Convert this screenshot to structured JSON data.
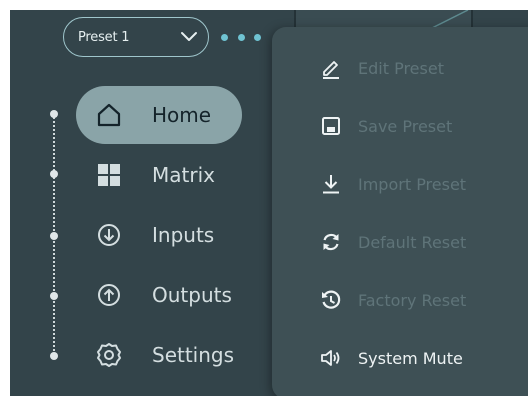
{
  "preset_selector": {
    "value": "Preset 1"
  },
  "nav": {
    "items": [
      {
        "label": "Home",
        "icon": "home-icon",
        "active": true
      },
      {
        "label": "Matrix",
        "icon": "grid-icon",
        "active": false
      },
      {
        "label": "Inputs",
        "icon": "arrow-down-circle-icon",
        "active": false
      },
      {
        "label": "Outputs",
        "icon": "arrow-up-circle-icon",
        "active": false
      },
      {
        "label": "Settings",
        "icon": "gear-icon",
        "active": false
      }
    ]
  },
  "preset_menu": {
    "items": [
      {
        "label": "Edit Preset",
        "icon": "pencil-icon",
        "enabled": false
      },
      {
        "label": "Save Preset",
        "icon": "floppy-disk-icon",
        "enabled": false
      },
      {
        "label": "Import Preset",
        "icon": "download-icon",
        "enabled": false
      },
      {
        "label": "Default Reset",
        "icon": "refresh-icon",
        "enabled": false
      },
      {
        "label": "Factory Reset",
        "icon": "history-icon",
        "enabled": false
      },
      {
        "label": "System Mute",
        "icon": "speaker-icon",
        "enabled": true
      }
    ]
  },
  "colors": {
    "background": "#33444a",
    "menu_background": "#3e5055",
    "active_nav": "#8aa4a8",
    "accent": "#6fc3d2",
    "disabled_text": "#5f7479"
  }
}
